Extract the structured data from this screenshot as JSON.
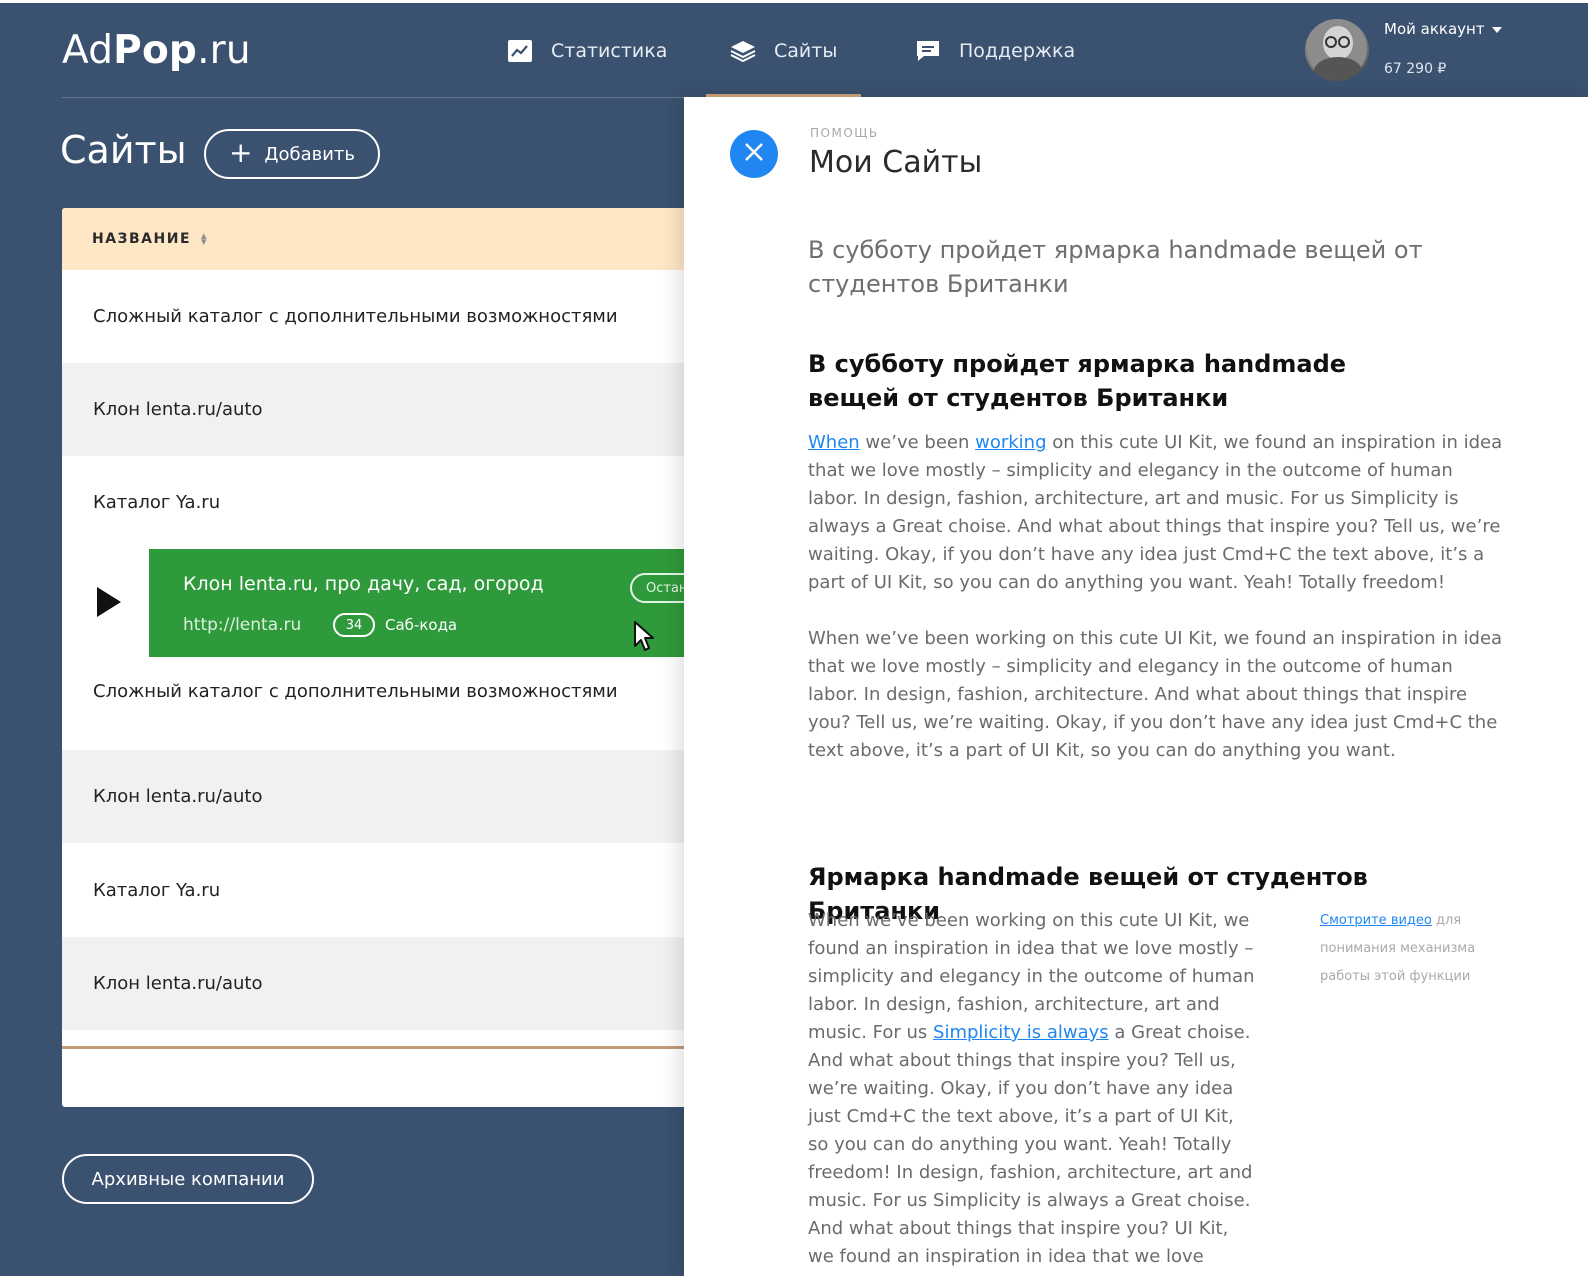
{
  "header": {
    "logo_prefix": "Ad",
    "logo_bold": "Pop",
    "logo_suffix": ".ru",
    "nav": [
      {
        "label": "Статистика",
        "icon": "chart-icon"
      },
      {
        "label": "Сайты",
        "icon": "layers-icon",
        "active": true
      },
      {
        "label": "Поддержка",
        "icon": "chat-icon"
      }
    ],
    "account_label": "Мой аккаунт",
    "balance": "67 290 ₽"
  },
  "page": {
    "title": "Сайты",
    "add_button": "Добавить",
    "archive_button": "Архивные компании"
  },
  "table": {
    "column_header": "НАЗВАНИЕ",
    "rows_before": [
      "Сложный каталог с дополнительными возможностями",
      "Клон lenta.ru/auto",
      "Каталог Ya.ru"
    ],
    "active_row": {
      "title": "Клон lenta.ru, про дачу, сад, огород",
      "url": "http://lenta.ru",
      "count": "34",
      "count_label": "Саб-кода",
      "stop_label": "Остан"
    },
    "rows_after": [
      "Сложный каталог с дополнительными возможностями",
      "Клон lenta.ru/auto",
      "Каталог Ya.ru",
      "Клон lenta.ru/auto"
    ]
  },
  "help": {
    "eyebrow": "ПОМОЩЬ",
    "title": "Мои Сайты",
    "lead": "В субботу пройдет ярмарка handmade вещей от студентов Британки",
    "heading1": "В субботу пройдет ярмарка handmade вещей от студентов Британки",
    "p1_link1": "When",
    "p1_text1": " we’ve been ",
    "p1_link2": "working",
    "p1_text2": " on this cute UI Kit, we found an inspiration in idea that we love mostly – simplicity and elegancy in the outcome of human labor. In design, fashion, architecture, art and music. For us Simplicity is always a Great choise. And what about things that inspire you? Tell us, we’re waiting. Okay, if you don’t have any idea  just Cmd+C the text above, it’s a part of UI Kit, so you can do anything you want. Yeah! Totally freedom!",
    "p2": "When we’ve been working on this cute UI Kit, we found an inspiration in idea that we love mostly – simplicity and elegancy in the outcome of human labor. In design, fashion, architecture. And what about things that inspire you? Tell us, we’re waiting. Okay, if you don’t have any idea  just Cmd+C the text above, it’s a part of UI Kit, so you can do anything you want.",
    "heading2": "Ярмарка handmade вещей от студентов Британки",
    "p3_text1": "When we’ve been working on this cute UI Kit, we found an inspiration in idea that we love mostly – simplicity and elegancy in the outcome of human labor. In design, fashion, architecture, art and music. For us ",
    "p3_link": "Simplicity is always",
    "p3_text2": " a Great choise. And what about things that inspire you? Tell us, we’re waiting. Okay, if you don’t have any idea  just Cmd+C the text above, it’s a part of UI Kit, so you can do anything you want. Yeah! Totally freedom! In design, fashion, architecture, art and music. For us Simplicity is always a Great choise. And what about things that inspire you? UI Kit, we found an inspiration in idea that we love",
    "side_link": "Смотрите видео",
    "side_text": " для понимания механизма работы этой функции"
  }
}
